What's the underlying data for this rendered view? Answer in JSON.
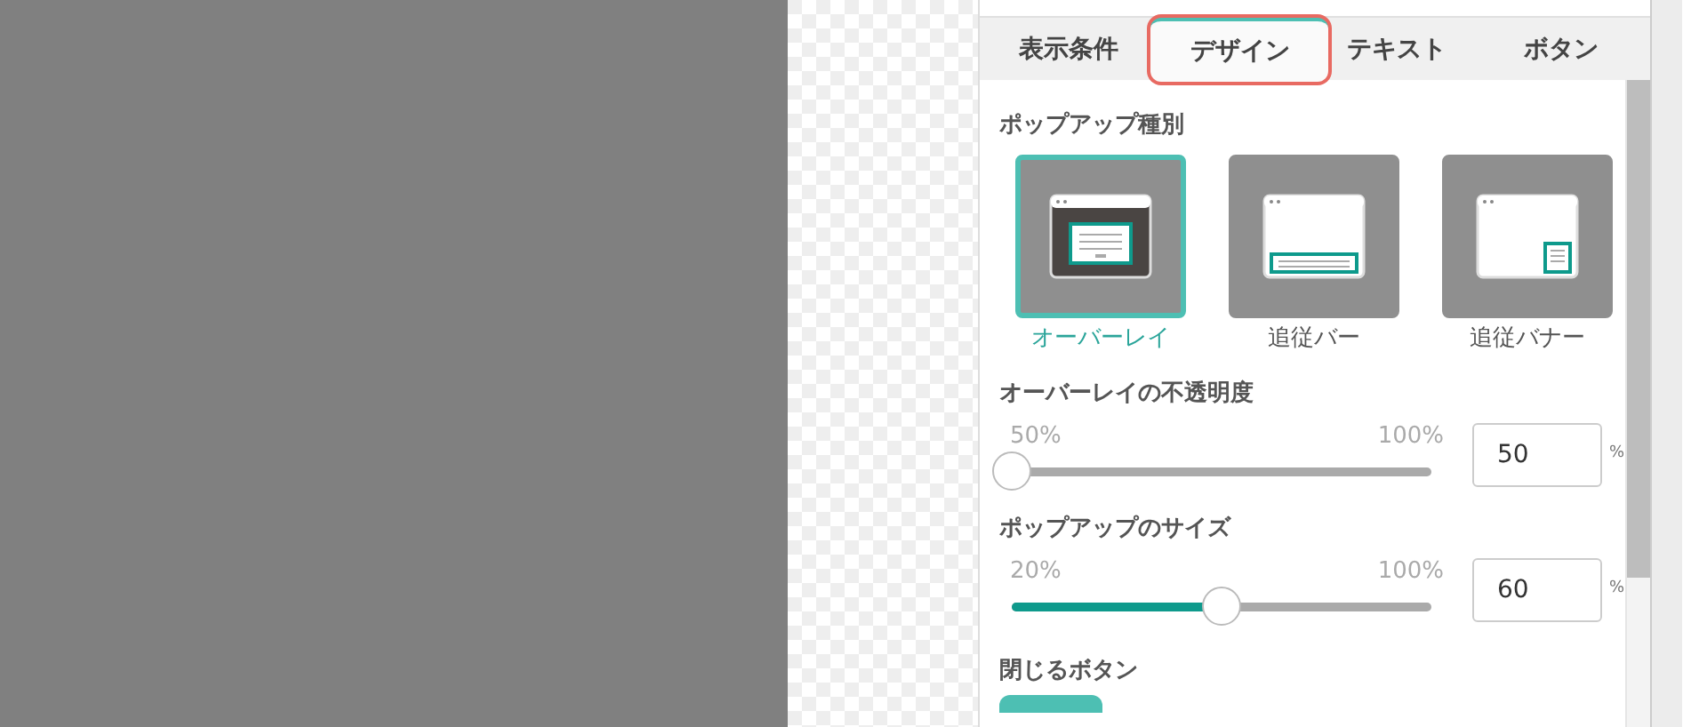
{
  "tabs": [
    {
      "label": "表示条件",
      "selected": false
    },
    {
      "label": "デザイン",
      "selected": true
    },
    {
      "label": "テキスト",
      "selected": false
    },
    {
      "label": "ボタン",
      "selected": false
    }
  ],
  "popup_type": {
    "heading": "ポップアップ種別",
    "options": [
      {
        "kind": "overlay",
        "label": "オーバーレイ",
        "selected": true
      },
      {
        "kind": "bar",
        "label": "追従バー",
        "selected": false
      },
      {
        "kind": "banner",
        "label": "追従バナー",
        "selected": false
      }
    ]
  },
  "sliders": [
    {
      "heading": "オーバーレイの不透明度",
      "min": "50%",
      "max": "100%",
      "level": 0,
      "value": "50",
      "unit": "%"
    },
    {
      "heading": "ポップアップのサイズ",
      "min": "20%",
      "max": "100%",
      "level": 0.5,
      "value": "60",
      "unit": "%"
    }
  ],
  "close_button": {
    "heading": "閉じるボタン",
    "on": true
  }
}
